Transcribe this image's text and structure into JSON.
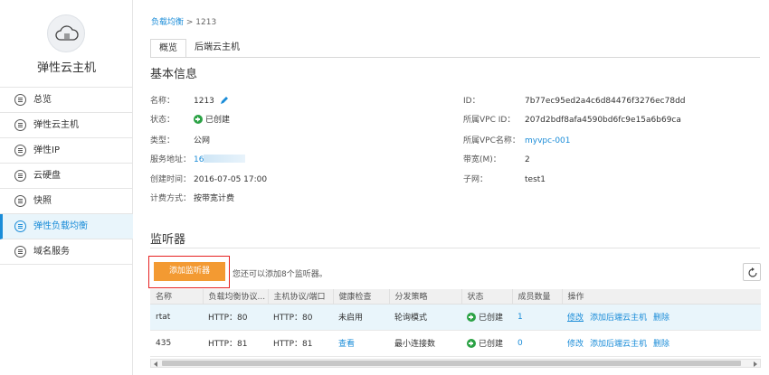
{
  "sidebar": {
    "title": "弹性云主机",
    "items": [
      {
        "label": "总览",
        "icon": "overview-icon"
      },
      {
        "label": "弹性云主机",
        "icon": "server-icon"
      },
      {
        "label": "弹性IP",
        "icon": "ip-icon"
      },
      {
        "label": "云硬盘",
        "icon": "disk-icon"
      },
      {
        "label": "快照",
        "icon": "snapshot-icon"
      },
      {
        "label": "弹性负载均衡",
        "icon": "load-balancer-icon",
        "active": true
      },
      {
        "label": "域名服务",
        "icon": "dns-icon"
      }
    ]
  },
  "breadcrumb": {
    "parent": "负载均衡",
    "sep": " > ",
    "current": "1213"
  },
  "tabs": [
    {
      "label": "概览",
      "active": true
    },
    {
      "label": "后端云主机"
    }
  ],
  "basic": {
    "title": "基本信息",
    "name_k": "名称：",
    "name_v": "1213",
    "state_k": "状态：",
    "state_v": "已创建",
    "type_k": "类型：",
    "type_v": "公网",
    "addr_k": "服务地址：",
    "addr_v": "16",
    "time_k": "创建时间：",
    "time_v": "2016-07-05 17:00",
    "bill_k": "计费方式：",
    "bill_v": "按带宽计费",
    "id_k": "ID：",
    "id_v": "7b77ec95ed2a4c6d84476f3276ec78dd",
    "vpcid_k": "所属VPC ID：",
    "vpcid_v": "207d2bdf8afa4590bd6fc9e15a6b69ca",
    "vpcname_k": "所属VPC名称：",
    "vpcname_v": "myvpc-001",
    "bw_k": "带宽(M)：",
    "bw_v": "2",
    "subnet_k": "子网：",
    "subnet_v": "test1"
  },
  "listener": {
    "title": "监听器",
    "add_label": "添加监听器",
    "hint": "您还可以添加8个监听器。",
    "columns": [
      "名称",
      "负载均衡协议...",
      "主机协议/端口",
      "健康检查",
      "分发策略",
      "状态",
      "成员数量",
      "操作"
    ],
    "rows": [
      {
        "name": "rtat",
        "lb": "HTTP：80",
        "host": "HTTP：80",
        "health": "未启用",
        "policy": "轮询模式",
        "status": "已创建",
        "members": "1",
        "op1": "修改",
        "op2": "添加后端云主机",
        "op3": "删除"
      },
      {
        "name": "435",
        "lb": "HTTP：81",
        "host": "HTTP：81",
        "health": "查看",
        "policy": "最小连接数",
        "status": "已创建",
        "members": "0",
        "op1": "修改",
        "op2": "添加后端云主机",
        "op3": "删除"
      }
    ]
  },
  "colors": {
    "accent": "#1a8cd8",
    "button": "#f39a32",
    "success": "#2ba245",
    "highlight": "#e62020"
  }
}
